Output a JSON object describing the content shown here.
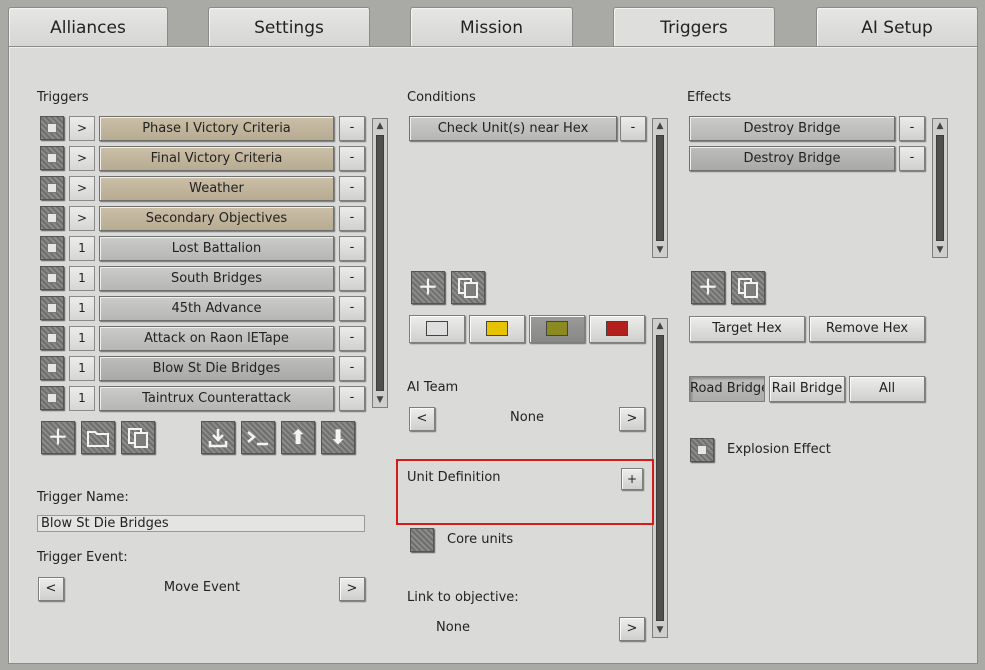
{
  "tabs": [
    {
      "label": "Alliances"
    },
    {
      "label": "Settings"
    },
    {
      "label": "Mission"
    },
    {
      "label": "Triggers"
    },
    {
      "label": "AI Setup"
    }
  ],
  "triggers": {
    "heading": "Triggers",
    "rows": [
      {
        "marker": ">",
        "label": "Phase I Victory Criteria",
        "style": "tan"
      },
      {
        "marker": ">",
        "label": "Final Victory Criteria",
        "style": "tan"
      },
      {
        "marker": ">",
        "label": "Weather",
        "style": "tan"
      },
      {
        "marker": ">",
        "label": "Secondary Objectives",
        "style": "tan"
      },
      {
        "marker": "1",
        "label": "Lost Battalion",
        "style": "gray"
      },
      {
        "marker": "1",
        "label": "South Bridges",
        "style": "gray"
      },
      {
        "marker": "1",
        "label": "45th Advance",
        "style": "gray"
      },
      {
        "marker": "1",
        "label": "Attack on Raon lETape",
        "style": "gray"
      },
      {
        "marker": "1",
        "label": "Blow St Die Bridges",
        "style": "sel"
      },
      {
        "marker": "1",
        "label": "Taintrux Counterattack",
        "style": "gray"
      }
    ],
    "remove_label": "-",
    "trigger_name_label": "Trigger Name:",
    "trigger_name_value": "Blow St Die Bridges",
    "trigger_event_label": "Trigger Event:",
    "trigger_event_value": "Move Event",
    "prev": "<",
    "next": ">"
  },
  "conditions": {
    "heading": "Conditions",
    "items": [
      {
        "label": "Check Unit(s) near Hex"
      }
    ],
    "remove_label": "-",
    "colors": [
      "#dedede",
      "#e6c200",
      "#8a8a20",
      "#b3201c"
    ],
    "ai_team_label": "AI Team",
    "ai_team_value": "None",
    "unit_definition_label": "Unit Definition",
    "unit_definition_add": "+",
    "core_units_label": "Core units",
    "link_objective_label": "Link to objective:",
    "link_objective_value": "None",
    "prev": "<",
    "next": ">"
  },
  "effects": {
    "heading": "Effects",
    "items": [
      {
        "label": "Destroy Bridge"
      },
      {
        "label": "Destroy Bridge"
      }
    ],
    "remove_label": "-",
    "target_hex": "Target Hex",
    "remove_hex": "Remove Hex",
    "road_bridge": "Road Bridge",
    "rail_bridge": "Rail Bridge",
    "all": "All",
    "explosion_label": "Explosion Effect"
  }
}
